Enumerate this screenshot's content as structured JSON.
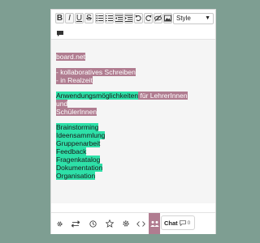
{
  "toolbar": {
    "bold": "B",
    "italic": "I",
    "underline": "U",
    "strike": "S",
    "style_label": "Style",
    "buttons": [
      "bold",
      "italic",
      "underline",
      "strikethrough",
      "bullet-list",
      "numbered-list",
      "indent-decrease",
      "indent-increase",
      "undo",
      "redo",
      "hide",
      "image",
      "comment"
    ]
  },
  "content": {
    "line1": "board.net",
    "line2": "- kollaboratives Schreiben",
    "line3": "- in Realzeit",
    "line4a": "Anwendungsmöglichkeiten",
    "line4b": " für LehrerInnen und",
    "line5": "SchülerInnen",
    "list": [
      "Brainstorming",
      "Ideensammlung",
      "Gruppenarbeit",
      "Feedback",
      "Fragenkatalog",
      "Dokumentation",
      "Organisation"
    ]
  },
  "bottombar": {
    "chat_label": "Chat",
    "chat_count": "0",
    "icons": [
      "settings-icon",
      "swap-icon",
      "history-icon",
      "star-icon",
      "gear-icon",
      "embed-icon",
      "users-icon"
    ]
  },
  "colors": {
    "page_bg": "#7e9e92",
    "pink_highlight": "#b07c90",
    "green_highlight": "#2ee0a8"
  }
}
